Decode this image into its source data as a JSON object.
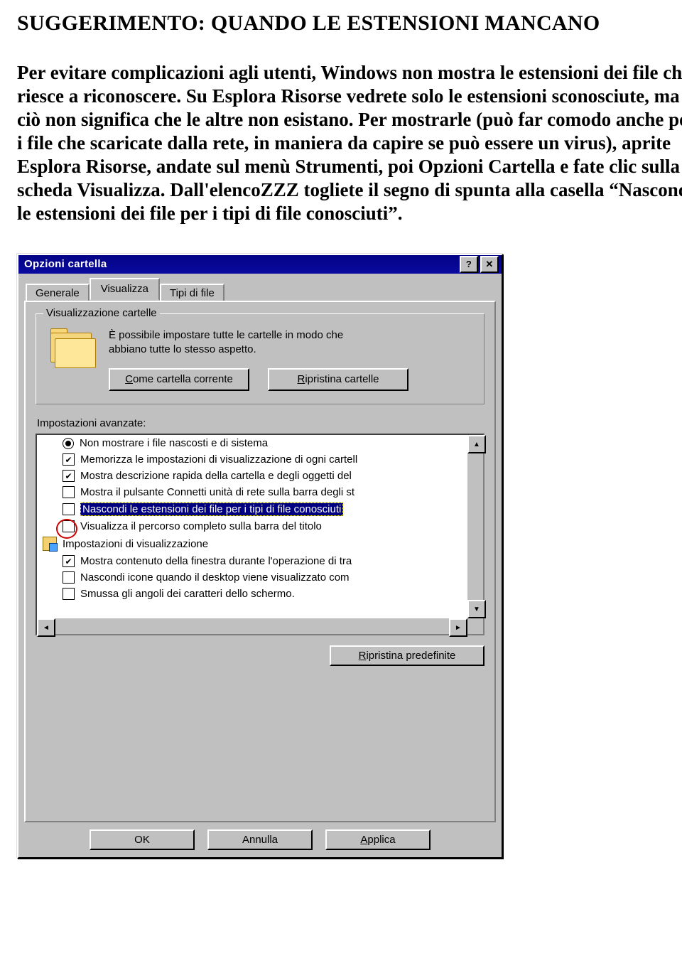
{
  "article": {
    "heading": "SUGGERIMENTO: QUANDO LE ESTENSIONI MANCANO",
    "paragraph": "Per evitare complicazioni agli utenti, Windows non mostra le estensioni dei file che riesce a riconoscere. Su Esplora Risorse vedrete solo le estensioni sconosciute, ma ciò non significa che le altre non esistano. Per mostrarle (può far comodo anche per i file che scaricate dalla rete, in maniera da capire se può essere un virus), aprite Esplora Risorse, andate sul menù Strumenti, poi Opzioni Cartella e fate clic sulla scheda Visualizza. Dall'elencoZZZ togliete il segno di spunta alla casella “Nascondi le estensioni dei file per i tipi di file conosciuti”."
  },
  "dialog": {
    "title": "Opzioni cartella",
    "tabs": {
      "generale": "Generale",
      "visualizza": "Visualizza",
      "tipi": "Tipi di file"
    },
    "groupbox": {
      "legend": "Visualizzazione cartelle",
      "line1": "È possibile impostare tutte le cartelle in modo che",
      "line2": "abbiano tutte lo stesso aspetto.",
      "btn_current_pre": "C",
      "btn_current_rest": "ome cartella corrente",
      "btn_reset_pre": "R",
      "btn_reset_rest": "ipristina cartelle"
    },
    "adv_label": "Impostazioni avanzate:",
    "items": [
      {
        "kind": "radio",
        "checked": true,
        "text": "Non mostrare i file nascosti e di sistema"
      },
      {
        "kind": "check",
        "checked": true,
        "text": "Memorizza le impostazioni di visualizzazione di ogni cartell"
      },
      {
        "kind": "check",
        "checked": true,
        "text": "Mostra descrizione rapida della cartella e degli oggetti del"
      },
      {
        "kind": "check",
        "checked": false,
        "text": "Mostra il pulsante Connetti unità di rete sulla barra degli st"
      },
      {
        "kind": "check",
        "checked": false,
        "selected": true,
        "text": "Nascondi le estensioni dei file per i tipi di file conosciuti"
      },
      {
        "kind": "check",
        "checked": false,
        "text": "Visualizza il percorso completo sulla barra del titolo"
      },
      {
        "kind": "section",
        "text": "Impostazioni di visualizzazione"
      },
      {
        "kind": "check",
        "checked": true,
        "text": "Mostra contenuto della finestra durante l'operazione di tra"
      },
      {
        "kind": "check",
        "checked": false,
        "text": "Nascondi icone quando il desktop viene visualizzato com"
      },
      {
        "kind": "check",
        "checked": false,
        "text": "Smussa gli angoli dei caratteri dello schermo."
      }
    ],
    "restore_pre": "R",
    "restore_rest": "ipristina predefinite",
    "footer": {
      "ok": "OK",
      "cancel": "Annulla",
      "apply_pre": "A",
      "apply_rest": "pplica"
    }
  }
}
